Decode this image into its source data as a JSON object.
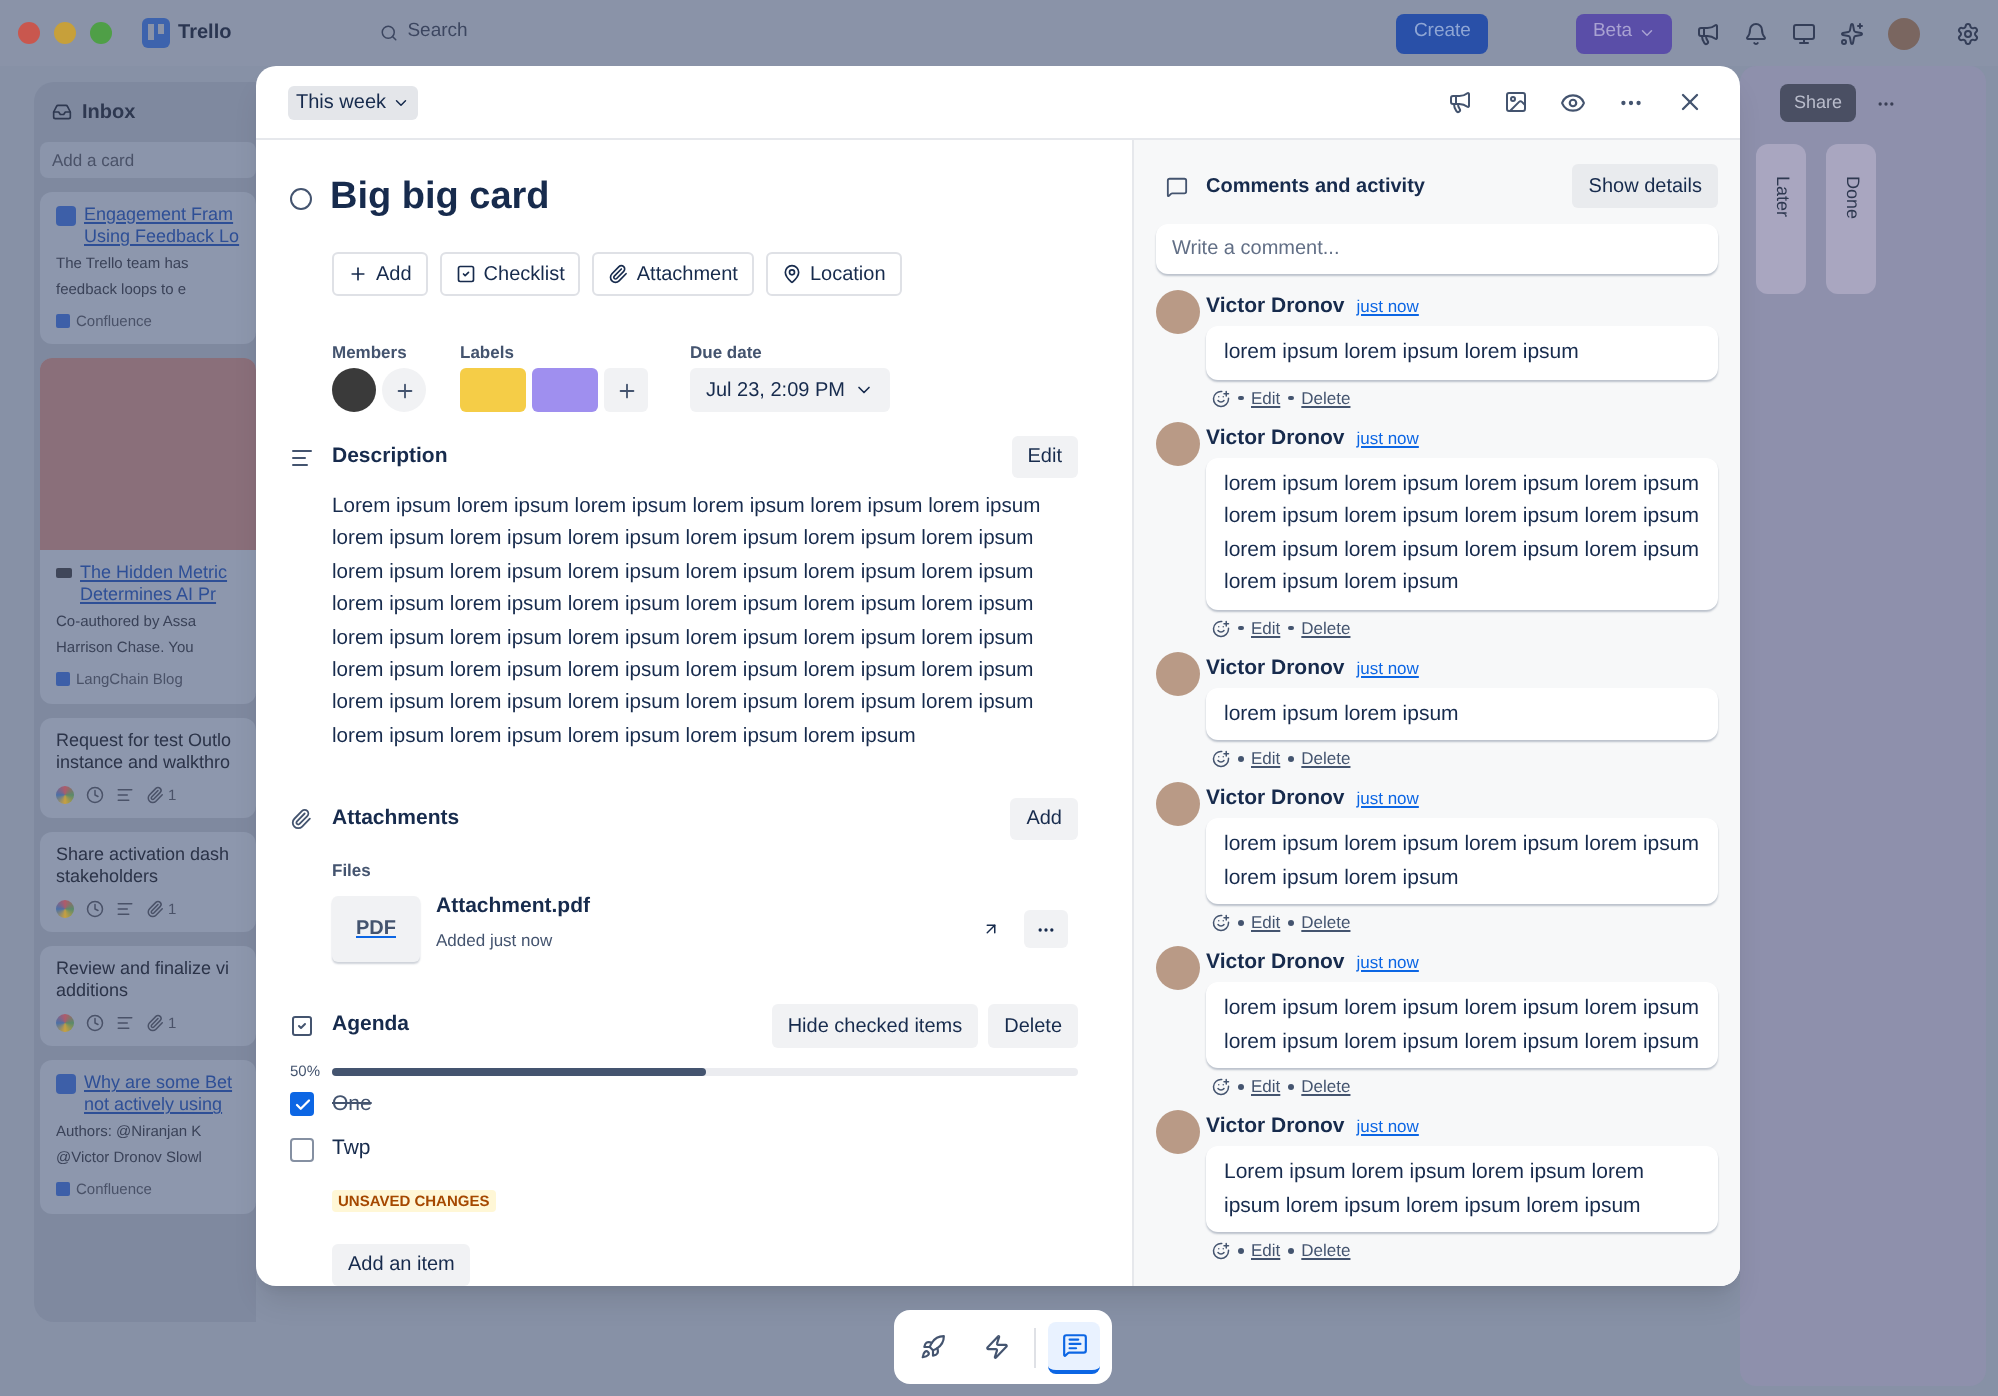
{
  "app_bar": {
    "brand": "Trello",
    "search": {
      "placeholder": "Search"
    },
    "create": "Create",
    "beta": "Beta"
  },
  "board": {
    "share": "Share",
    "inbox": {
      "title": "Inbox",
      "add_card": "Add a card",
      "cards": [
        {
          "kind": "link",
          "title": "Engagement Fram",
          "title_2": "Using Feedback Lo",
          "description": "The Trello team has",
          "description_2": "feedback loops to e",
          "source": "Confluence"
        },
        {
          "kind": "image_link",
          "title": "The Hidden Metric",
          "title_2": "Determines AI Pr",
          "description": "Co-authored by Assa",
          "description_2": "Harrison Chase. You",
          "source": "LangChain Blog"
        },
        {
          "kind": "task",
          "title": "Request for test Outlo",
          "title_2": "instance and walkthro",
          "attachments": "1"
        },
        {
          "kind": "task",
          "title": "Share activation dash",
          "title_2": "stakeholders",
          "attachments": "1"
        },
        {
          "kind": "task",
          "title": "Review and finalize vi",
          "title_2": "additions",
          "attachments": "1"
        },
        {
          "kind": "link",
          "title": "Why are some Bet",
          "title_2": "not actively using",
          "description": "Authors: @Niranjan K",
          "description_2": "@Victor Dronov Slowl",
          "source": "Confluence"
        }
      ]
    },
    "collapsed_lists": [
      {
        "name": "Later"
      },
      {
        "name": "Done"
      }
    ]
  },
  "card": {
    "list": "This week",
    "title": "Big big card",
    "completed": false,
    "actions": [
      {
        "kind": "add",
        "label": "Add"
      },
      {
        "kind": "checklist",
        "label": "Checklist"
      },
      {
        "kind": "attachment",
        "label": "Attachment"
      },
      {
        "kind": "location",
        "label": "Location"
      }
    ],
    "members_label": "Members",
    "labels_label": "Labels",
    "labels": [
      {
        "color": "#f5cd47"
      },
      {
        "color": "#9f8fef"
      }
    ],
    "due_date_label": "Due date",
    "due_date": "Jul 23, 2:09 PM",
    "description": {
      "title": "Description",
      "edit": "Edit",
      "text": "Lorem ipsum lorem ipsum lorem ipsum lorem ipsum lorem ipsum lorem ipsum lorem ipsum lorem ipsum lorem ipsum lorem ipsum lorem ipsum lorem ipsum lorem ipsum lorem ipsum lorem ipsum lorem ipsum lorem ipsum lorem ipsum lorem ipsum lorem ipsum lorem ipsum lorem ipsum lorem ipsum lorem ipsum lorem ipsum lorem ipsum lorem ipsum lorem ipsum lorem ipsum lorem ipsum lorem ipsum lorem ipsum lorem ipsum lorem ipsum lorem ipsum lorem ipsum lorem ipsum lorem ipsum lorem ipsum lorem ipsum lorem ipsum lorem ipsum lorem ipsum lorem ipsum lorem ipsum lorem ipsum lorem ipsum"
    },
    "attachments": {
      "title": "Attachments",
      "add": "Add",
      "files_label": "Files",
      "files": [
        {
          "thumb": "PDF",
          "name": "Attachment.pdf",
          "added": "Added just now"
        }
      ]
    },
    "checklist": {
      "title": "Agenda",
      "hide": "Hide checked items",
      "delete": "Delete",
      "percent": "50%",
      "level": 0.5,
      "items": [
        {
          "label": "One",
          "checked": true
        },
        {
          "label": "Twp",
          "checked": false
        }
      ],
      "unsaved": "UNSAVED CHANGES",
      "add_item": "Add an item"
    }
  },
  "activity": {
    "title": "Comments and activity",
    "show_details": "Show details",
    "comment_placeholder": "Write a comment...",
    "comments": [
      {
        "author": "Victor Dronov",
        "time": "just now",
        "text": "lorem ipsum lorem ipsum lorem ipsum",
        "actions": [
          "Edit",
          "Delete"
        ]
      },
      {
        "author": "Victor Dronov",
        "time": "just now",
        "text": "lorem ipsum lorem ipsum lorem ipsum lorem ipsum lorem ipsum lorem ipsum lorem ipsum lorem ipsum lorem ipsum lorem ipsum lorem ipsum lorem ipsum lorem ipsum lorem ipsum",
        "actions": [
          "Edit",
          "Delete"
        ]
      },
      {
        "author": "Victor Dronov",
        "time": "just now",
        "text": "lorem ipsum lorem ipsum",
        "actions": [
          "Edit",
          "Delete"
        ]
      },
      {
        "author": "Victor Dronov",
        "time": "just now",
        "text": "lorem ipsum lorem ipsum lorem ipsum lorem ipsum lorem ipsum lorem ipsum",
        "actions": [
          "Edit",
          "Delete"
        ]
      },
      {
        "author": "Victor Dronov",
        "time": "just now",
        "text": "lorem ipsum lorem ipsum lorem ipsum lorem ipsum lorem ipsum lorem ipsum lorem ipsum lorem ipsum",
        "actions": [
          "Edit",
          "Delete"
        ]
      },
      {
        "author": "Victor Dronov",
        "time": "just now",
        "text": "Lorem ipsum lorem ipsum lorem ipsum lorem ipsum lorem ipsum lorem ipsum lorem ipsum",
        "actions": [
          "Edit",
          "Delete"
        ]
      }
    ]
  },
  "dock": [
    {
      "kind": "rocket",
      "selected": false
    },
    {
      "kind": "zap",
      "selected": false
    },
    {
      "kind": "comment",
      "selected": true
    }
  ]
}
